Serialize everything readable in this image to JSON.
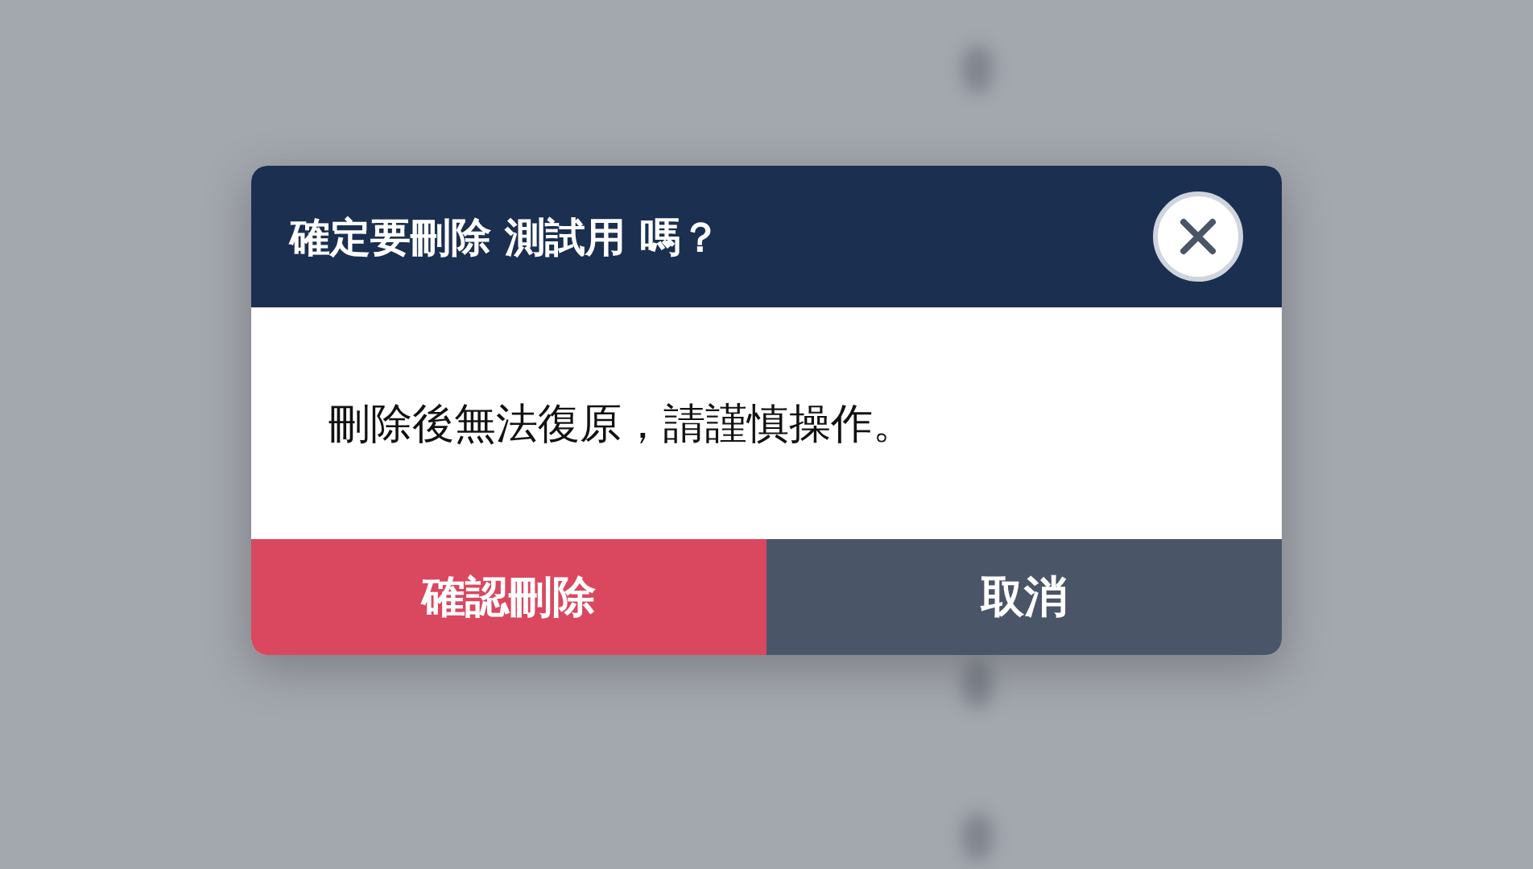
{
  "dialog": {
    "title": "確定要刪除 測試用 嗎？",
    "message": "刪除後無法復原，請謹慎操作。",
    "buttons": [
      {
        "label": "確認刪除",
        "kind": "danger"
      },
      {
        "label": "取消",
        "kind": "cancel"
      }
    ]
  }
}
